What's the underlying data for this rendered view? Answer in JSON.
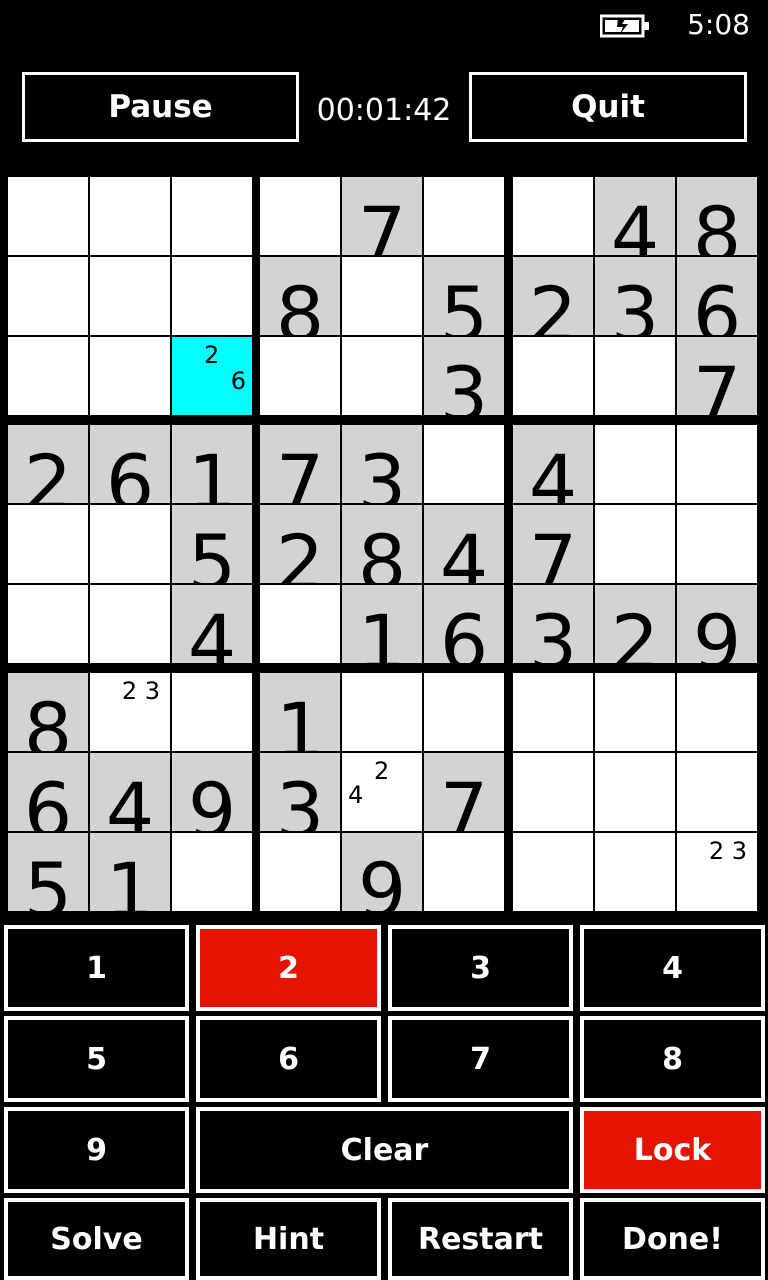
{
  "status": {
    "time": "5:08",
    "battery_icon": "battery-charging-icon"
  },
  "header": {
    "pause_label": "Pause",
    "quit_label": "Quit",
    "timer": "00:01:42"
  },
  "grid": {
    "rows": [
      [
        "",
        "",
        "",
        "",
        "7",
        "",
        "",
        "4",
        "8"
      ],
      [
        "",
        "",
        "",
        "8",
        "",
        "5",
        "2",
        "3",
        "6"
      ],
      [
        "",
        "",
        "",
        "",
        "",
        "3",
        "",
        "",
        "7"
      ],
      [
        "2",
        "6",
        "1",
        "7",
        "3",
        "",
        "4",
        "",
        ""
      ],
      [
        "",
        "",
        "5",
        "2",
        "8",
        "4",
        "7",
        "",
        ""
      ],
      [
        "",
        "",
        "4",
        "",
        "1",
        "6",
        "3",
        "2",
        "9"
      ],
      [
        "8",
        "",
        "",
        "1",
        "",
        "",
        "",
        "",
        ""
      ],
      [
        "6",
        "4",
        "9",
        "3",
        "",
        "7",
        "",
        "",
        ""
      ],
      [
        "5",
        "1",
        "",
        "",
        "9",
        "",
        "",
        "",
        ""
      ]
    ],
    "given": [
      [
        0,
        0,
        0,
        0,
        1,
        0,
        0,
        1,
        1
      ],
      [
        0,
        0,
        0,
        1,
        0,
        1,
        1,
        1,
        1
      ],
      [
        0,
        0,
        0,
        0,
        0,
        1,
        0,
        0,
        1
      ],
      [
        1,
        1,
        1,
        1,
        1,
        0,
        1,
        0,
        0
      ],
      [
        0,
        0,
        1,
        1,
        1,
        1,
        1,
        0,
        0
      ],
      [
        0,
        0,
        1,
        0,
        1,
        1,
        1,
        1,
        1
      ],
      [
        1,
        0,
        0,
        1,
        0,
        0,
        0,
        0,
        0
      ],
      [
        1,
        1,
        1,
        1,
        0,
        1,
        0,
        0,
        0
      ],
      [
        1,
        1,
        0,
        0,
        1,
        0,
        0,
        0,
        0
      ]
    ],
    "selected": {
      "row": 2,
      "col": 2
    },
    "notes": [
      {
        "row": 2,
        "col": 2,
        "items": [
          {
            "text": "2",
            "slot": "top-center"
          },
          {
            "text": "6",
            "slot": "middle-right"
          }
        ]
      },
      {
        "row": 6,
        "col": 1,
        "items": [
          {
            "text": "2 3",
            "slot": "top-right"
          }
        ]
      },
      {
        "row": 7,
        "col": 4,
        "items": [
          {
            "text": "4",
            "slot": "middle-left"
          },
          {
            "text": "2",
            "slot": "top-center"
          }
        ]
      },
      {
        "row": 8,
        "col": 8,
        "items": [
          {
            "text": "2 3",
            "slot": "top-right"
          }
        ]
      }
    ]
  },
  "keypad": {
    "rows": [
      [
        {
          "label": "1"
        },
        {
          "label": "2",
          "active": true
        },
        {
          "label": "3"
        },
        {
          "label": "4"
        }
      ],
      [
        {
          "label": "5"
        },
        {
          "label": "6"
        },
        {
          "label": "7"
        },
        {
          "label": "8"
        }
      ],
      [
        {
          "label": "9"
        },
        {
          "label": "Clear",
          "span": 2
        },
        {
          "label": "Lock",
          "active": true
        }
      ],
      [
        {
          "label": "Solve"
        },
        {
          "label": "Hint"
        },
        {
          "label": "Restart"
        },
        {
          "label": "Done!"
        }
      ]
    ]
  },
  "colors": {
    "selected_cell": "#00ffff",
    "active_button": "#e51400",
    "given_cell": "#d3d3d3"
  }
}
